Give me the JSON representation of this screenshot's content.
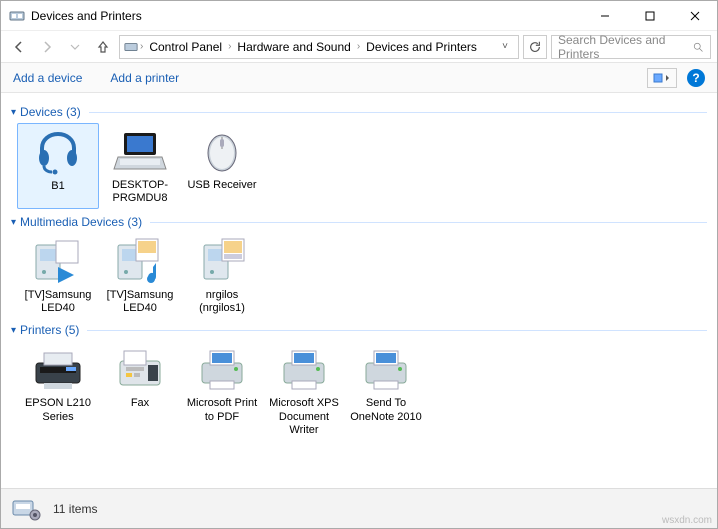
{
  "window": {
    "title": "Devices and Printers"
  },
  "breadcrumb": {
    "items": [
      "Control Panel",
      "Hardware and Sound",
      "Devices and Printers"
    ]
  },
  "search": {
    "placeholder": "Search Devices and Printers"
  },
  "toolbar": {
    "add_device_label": "Add a device",
    "add_printer_label": "Add a printer",
    "help_label": "?"
  },
  "groups": [
    {
      "name": "Devices",
      "count": 3,
      "items": [
        {
          "label": "B1",
          "icon": "bluetooth-headset",
          "selected": true
        },
        {
          "label": "DESKTOP-PRGMDU8",
          "icon": "laptop",
          "selected": false
        },
        {
          "label": "USB Receiver",
          "icon": "mouse",
          "selected": false
        }
      ]
    },
    {
      "name": "Multimedia Devices",
      "count": 3,
      "items": [
        {
          "label": "[TV]Samsung LED40",
          "icon": "media-server-play",
          "selected": false
        },
        {
          "label": "[TV]Samsung LED40",
          "icon": "media-server-music",
          "selected": false
        },
        {
          "label": "nrgilos (nrgilos1)",
          "icon": "media-server",
          "selected": false
        }
      ]
    },
    {
      "name": "Printers",
      "count": 5,
      "items": [
        {
          "label": "EPSON L210 Series",
          "icon": "printer-epson",
          "selected": false
        },
        {
          "label": "Fax",
          "icon": "fax",
          "selected": false
        },
        {
          "label": "Microsoft Print to PDF",
          "icon": "printer",
          "selected": false
        },
        {
          "label": "Microsoft XPS Document Writer",
          "icon": "printer",
          "selected": false
        },
        {
          "label": "Send To OneNote 2010",
          "icon": "printer",
          "selected": false
        }
      ]
    }
  ],
  "status": {
    "text": "11 items"
  },
  "watermark": "wsxdn.com"
}
